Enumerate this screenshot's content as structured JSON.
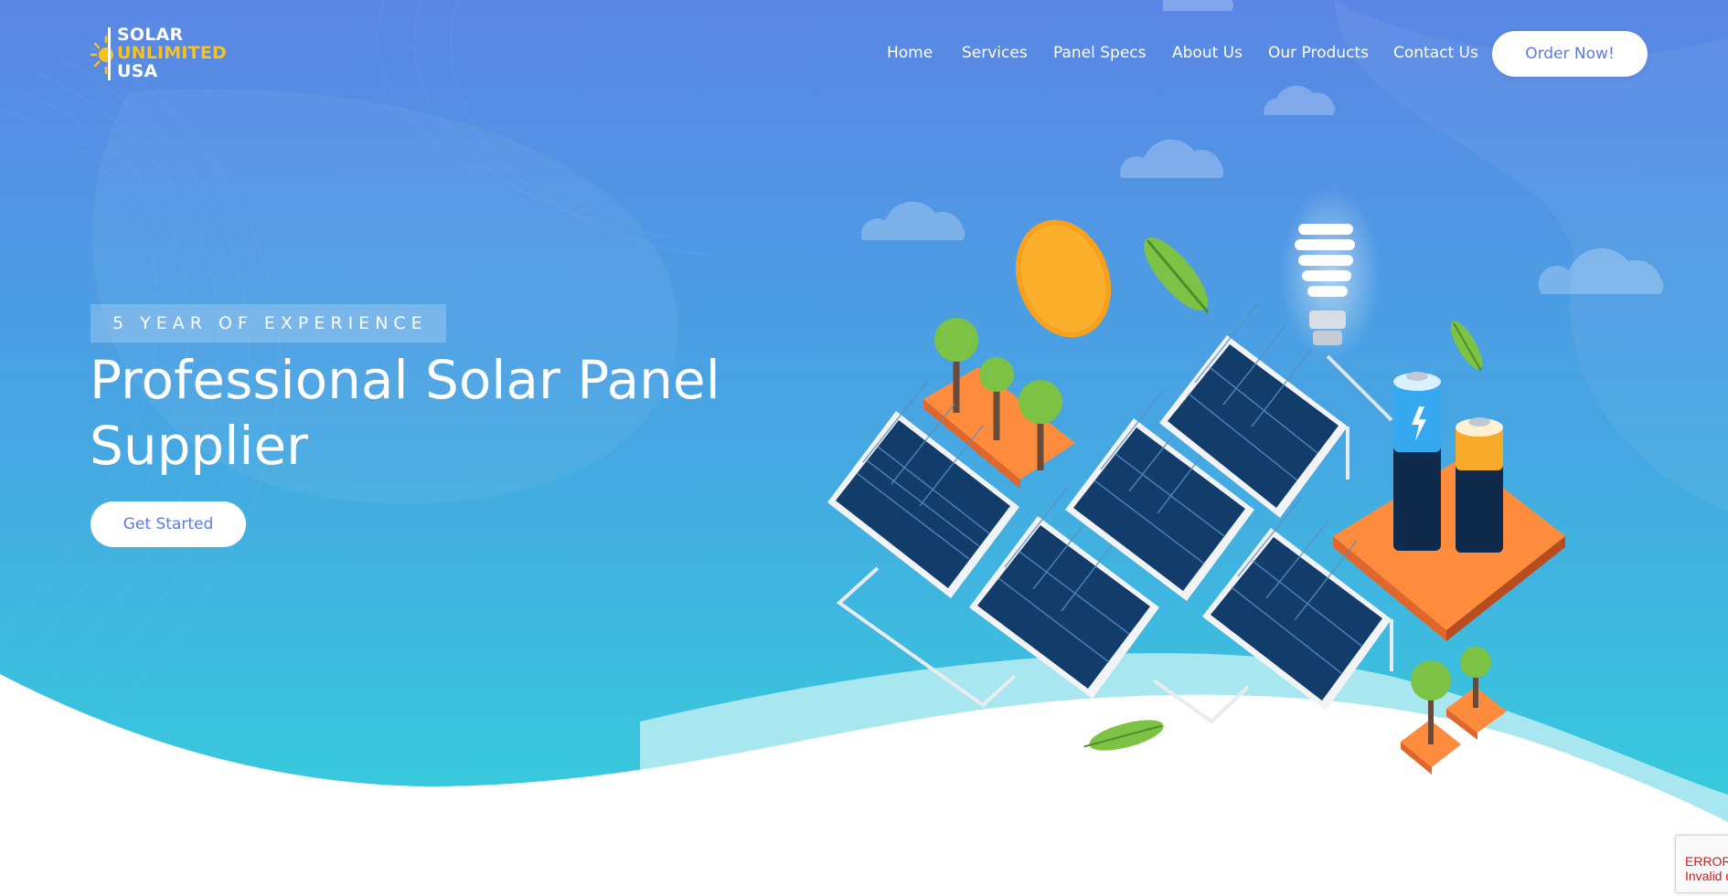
{
  "brand": {
    "logo_line1": "SOLAR",
    "logo_line2": "UNLIMITED",
    "logo_line3": "USA",
    "accent_yellow": "#f9c21a"
  },
  "nav": {
    "items": [
      {
        "label": "Home"
      },
      {
        "label": "Services"
      },
      {
        "label": "Panel Specs"
      },
      {
        "label": "About Us"
      },
      {
        "label": "Our Products"
      },
      {
        "label": "Contact Us"
      }
    ],
    "cta_label": "Order Now!"
  },
  "hero": {
    "badge": "5 YEAR OF EXPERIENCE",
    "title_line1": "Professional Solar Panel",
    "title_line2": "Supplier",
    "button_label": "Get Started"
  },
  "recaptcha": {
    "line1": "ERROR",
    "line2": "Invalid d"
  },
  "colors": {
    "gradient_top": "#5b86e5",
    "gradient_bottom": "#36d1dc",
    "button_text": "#5a7be0",
    "panel_dark": "#0f3560",
    "platform_orange": "#ff8a3d"
  },
  "icons": [
    "sun-logo-icon",
    "solar-panel-icon",
    "battery-icon",
    "light-bulb-icon",
    "tree-icon",
    "leaf-icon",
    "cloud-icon",
    "sun-icon"
  ]
}
